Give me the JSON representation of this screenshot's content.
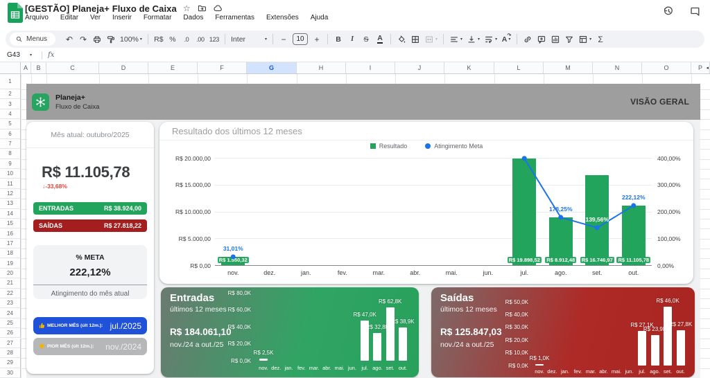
{
  "titlebar": {
    "title": "[GESTÃO] Planeja+ Fluxo de Caixa",
    "menus": [
      "Arquivo",
      "Editar",
      "Ver",
      "Inserir",
      "Formatar",
      "Dados",
      "Ferramentas",
      "Extensões",
      "Ajuda"
    ]
  },
  "icons": {
    "star": "☆",
    "undo": "↶",
    "redo": "↷",
    "caret": "▾",
    "minus": "−",
    "plus": "+",
    "col_overflow": "◂",
    "rotate_arrow": "↷"
  },
  "toolbar": {
    "menus_button": "Menus",
    "zoom": "100%",
    "currency": "R$",
    "percent": "%",
    "dec_decrease": ".0",
    "dec_increase": ".00",
    "format_123": "123",
    "font": "Inter",
    "font_size": "10",
    "bold": "B",
    "italic": "I",
    "strike": "S",
    "text_color": "A",
    "sigma": "Σ"
  },
  "formula_bar": {
    "cell_ref": "G43",
    "fx": "fx"
  },
  "grid": {
    "columns": [
      "A",
      "B",
      "C",
      "D",
      "E",
      "F",
      "G",
      "H",
      "I",
      "J",
      "K",
      "L",
      "M",
      "N",
      "O",
      "P"
    ],
    "highlighted_column": "G",
    "rows": 30
  },
  "header_band": {
    "brand_name": "Planeja+",
    "brand_subtitle": "Fluxo de Caixa",
    "view_title": "VISÃO GERAL"
  },
  "summary_card": {
    "month_label": "Mês atual: outubro/2025",
    "balance": "R$ 11.105,78",
    "change": "↓-33,68%",
    "entradas_label": "ENTRADAS",
    "entradas_value": "R$ 38.924,00",
    "saidas_label": "SAÍDAS",
    "saidas_value": "R$ 27.818,22",
    "meta_label": "% META",
    "meta_value": "222,12%",
    "meta_caption": "Atingimento do mês atual",
    "best_label": "MELHOR MÊS (últ 12m.):",
    "best_value": "jul./2025",
    "worst_label": "PIOR MÊS (últ 12m.):",
    "worst_value": "nov./2024"
  },
  "colors": {
    "accent_green": "#23a45c",
    "accent_red": "#a41d1f",
    "line_blue": "#1a73e8",
    "best_pill_blue": "#1f51d9",
    "worst_pill_gray": "#b5b7b9",
    "band_gray": "#9e9e9e",
    "negative_red": "#e04438"
  },
  "chart_data": [
    {
      "id": "resultado-12-meses",
      "type": "bar",
      "title": "Resultado dos últimos 12 meses",
      "categories": [
        "nov.",
        "dez.",
        "jan.",
        "fev.",
        "mar.",
        "abr.",
        "mai.",
        "jun.",
        "jul.",
        "ago.",
        "set.",
        "out."
      ],
      "series": [
        {
          "name": "Resultado",
          "type": "bar",
          "color": "#23a45c",
          "values": [
            1550.32,
            null,
            null,
            null,
            null,
            null,
            null,
            null,
            19898.52,
            8912.48,
            16746.97,
            11105.78
          ],
          "labels": [
            "R$ 1.550,32",
            null,
            null,
            null,
            null,
            null,
            null,
            null,
            "R$ 19.898,52",
            "R$ 8.912,48",
            "R$ 16.746,97",
            "R$ 11.105,78"
          ]
        },
        {
          "name": "Atingimento Meta",
          "type": "line",
          "color": "#1a73e8",
          "values": [
            31.01,
            null,
            null,
            null,
            null,
            null,
            null,
            null,
            397.97,
            178.25,
            139.56,
            222.12
          ],
          "labels": [
            "31,01%",
            null,
            null,
            null,
            null,
            null,
            null,
            null,
            null,
            "178,25%",
            "139,56%",
            "222,12%"
          ],
          "label_colors": {
            "10": "#ffffff"
          }
        }
      ],
      "axes": {
        "left_ticks": [
          "R$ 20.000,00",
          "R$ 15.000,00",
          "R$ 10.000,00",
          "R$ 5.000,00",
          "R$ 0,00"
        ],
        "left_max": 20000,
        "right_ticks": [
          "400,00%",
          "300,00%",
          "200,00%",
          "100,00%",
          "0,00%"
        ],
        "right_max": 400
      },
      "legend_position": "top-center",
      "grid": true
    },
    {
      "id": "entradas-12-meses",
      "type": "bar",
      "title": "Entradas",
      "subtitle": "últimos 12 meses",
      "total": "R$ 184.061,10",
      "period": "nov./24 a out./25",
      "unit": "K",
      "categories": [
        "nov.",
        "dez.",
        "jan.",
        "fev.",
        "mar.",
        "abr.",
        "mai.",
        "jun.",
        "jul.",
        "ago.",
        "set.",
        "out."
      ],
      "values": [
        2.5,
        null,
        null,
        null,
        null,
        null,
        null,
        null,
        47.0,
        32.8,
        62.8,
        38.9
      ],
      "labels": [
        "R$ 2,5K",
        null,
        null,
        null,
        null,
        null,
        null,
        null,
        "R$ 47,0K",
        "R$ 32,8K",
        "R$ 62,8K",
        "R$ 38,9K"
      ],
      "y_ticks": [
        "R$ 80,0K",
        "R$ 60,0K",
        "R$ 40,0K",
        "R$ 20,0K",
        "R$ 0,0K"
      ],
      "ymax": 80,
      "bar_color": "#ffffff"
    },
    {
      "id": "saidas-12-meses",
      "type": "bar",
      "title": "Saídas",
      "subtitle": "últimos 12 meses",
      "total": "R$ 125.847,03",
      "period": "nov./24 a out./25",
      "unit": "K",
      "categories": [
        "nov.",
        "dez.",
        "jan.",
        "fev.",
        "mar.",
        "abr.",
        "mai.",
        "jun.",
        "jul.",
        "ago.",
        "set.",
        "out."
      ],
      "values": [
        1.0,
        null,
        null,
        null,
        null,
        null,
        null,
        null,
        27.1,
        23.9,
        46.0,
        27.8
      ],
      "labels": [
        "R$ 1,0K",
        null,
        null,
        null,
        null,
        null,
        null,
        null,
        "R$ 27,1K",
        "R$ 23,9K",
        "R$ 46,0K",
        "R$ 27,8K"
      ],
      "y_ticks": [
        "R$ 50,0K",
        "R$ 40,0K",
        "R$ 30,0K",
        "R$ 20,0K",
        "R$ 10,0K",
        "R$ 0,0K"
      ],
      "ymax": 50,
      "bar_color": "#ffffff"
    }
  ]
}
